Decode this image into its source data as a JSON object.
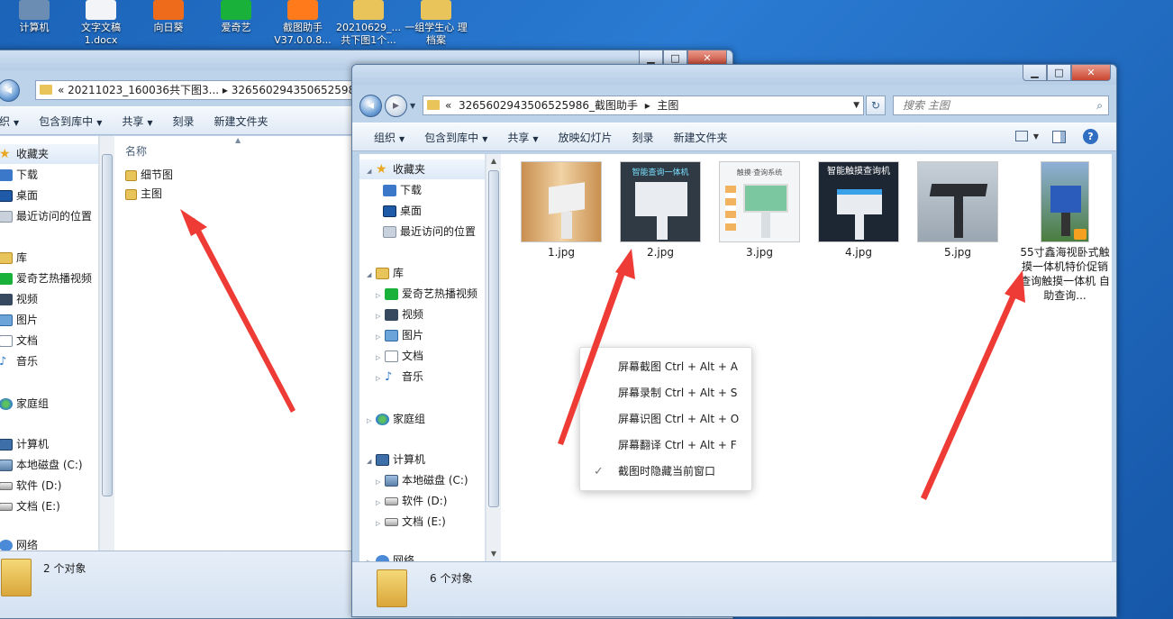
{
  "desktop_icons": [
    {
      "label": "计算机",
      "color": "#6b8db3"
    },
    {
      "label": "文字文稿 1.docx",
      "color": "#f2f4f7"
    },
    {
      "label": "向日葵",
      "color": "#ef6b1c"
    },
    {
      "label": "爱奇艺",
      "color": "#19b13a"
    },
    {
      "label": "截图助手 V37.0.0.8...",
      "color": "#ff7a1a"
    },
    {
      "label": "20210629_... 共下图1个...",
      "color": "#e8c45b"
    },
    {
      "label": "一组学生心 理档案",
      "color": "#e8c45b"
    }
  ],
  "back_window": {
    "address": "« 20211023_160036共下图3... ▸ 326560294350652598",
    "toolbar": [
      "织",
      "包含到库中",
      "共享",
      "刻录",
      "新建文件夹"
    ],
    "nav": {
      "favorites": "收藏夹",
      "downloads": "下载",
      "desktop": "桌面",
      "recent": "最近访问的位置",
      "libraries": "库",
      "iqiyi": "爱奇艺热播视频",
      "videos": "视频",
      "pictures": "图片",
      "documents": "文档",
      "music": "音乐",
      "homegroup": "家庭组",
      "computer": "计算机",
      "drive_c": "本地磁盘 (C:)",
      "drive_d": "软件 (D:)",
      "drive_e": "文档 (E:)",
      "network": "网络"
    },
    "column_header": "名称",
    "folders": [
      "细节图",
      "主图"
    ],
    "status": "2 个对象"
  },
  "front_window": {
    "address_prefix": "«",
    "address_folder": "326560294350652598​6_截图助手",
    "address_sep": "▸",
    "address_current": "主图",
    "search_placeholder": "搜索 主图",
    "toolbar": [
      "组织",
      "包含到库中",
      "共享",
      "放映幻灯片",
      "刻录",
      "新建文件夹"
    ],
    "nav": {
      "favorites": "收藏夹",
      "downloads": "下载",
      "desktop": "桌面",
      "recent": "最近访问的位置",
      "libraries": "库",
      "iqiyi": "爱奇艺热播视频",
      "videos": "视频",
      "pictures": "图片",
      "documents": "文档",
      "music": "音乐",
      "homegroup": "家庭组",
      "computer": "计算机",
      "drive_c": "本地磁盘 (C:)",
      "drive_d": "软件 (D:)",
      "drive_e": "文档 (E:)",
      "network": "网络"
    },
    "files": [
      {
        "name": "1.jpg",
        "bg": "#d7a86a",
        "accent": "#f0f0f0"
      },
      {
        "name": "2.jpg",
        "bg": "#2f3a44",
        "accent": "#e9edf1",
        "caption": "智能查询一体机"
      },
      {
        "name": "3.jpg",
        "bg": "#f3f5f7",
        "accent": "#d9dee3",
        "caption": "触摸·查询系统"
      },
      {
        "name": "4.jpg",
        "bg": "#1d2633",
        "accent": "#e8ecf0",
        "caption": "智能触摸查询机"
      },
      {
        "name": "5.jpg",
        "bg": "#b9c3cc",
        "accent": "#2a2e33"
      },
      {
        "name": "55寸鑫海视卧式触摸一体机特价促销 查询触摸一体机 自助查询...",
        "bg": "#4a7d3e",
        "accent": "#2b5cbc"
      }
    ],
    "status": "6 个对象"
  },
  "context_menu": [
    {
      "label": "屏幕截图 Ctrl + Alt + A",
      "checked": false
    },
    {
      "label": "屏幕录制 Ctrl + Alt + S",
      "checked": false
    },
    {
      "label": "屏幕识图 Ctrl + Alt + O",
      "checked": false
    },
    {
      "label": "屏幕翻译 Ctrl + Alt + F",
      "checked": false
    },
    {
      "label": "截图时隐藏当前窗口",
      "checked": true
    }
  ],
  "colors": {
    "arrow": "#ee3b35",
    "desktop": "#2a7bd3",
    "window_frame": "#bcd3ea"
  }
}
